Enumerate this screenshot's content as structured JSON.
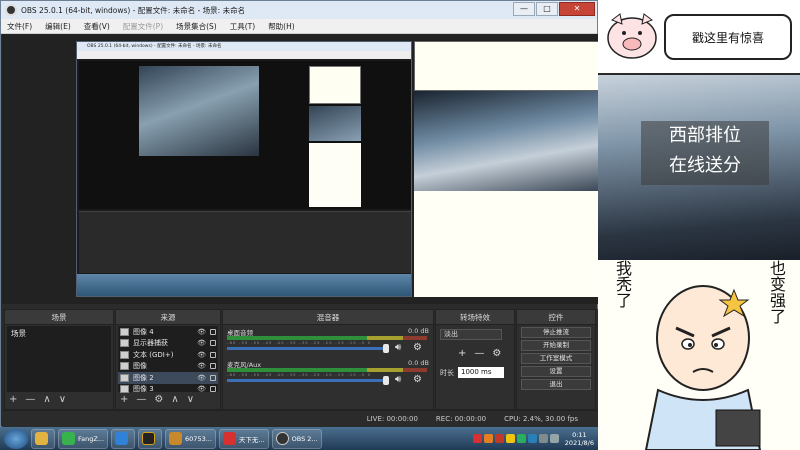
{
  "window": {
    "title": "OBS 25.0.1 (64-bit, windows) - 配置文件: 未命名 - 场景: 未命名",
    "controls": [
      "—",
      "□",
      "✕"
    ]
  },
  "menu": [
    "文件(F)",
    "编辑(E)",
    "查看(V)",
    "配置文件(P)",
    "场景集合(S)",
    "工具(T)",
    "帮助(H)"
  ],
  "nested_window": {
    "title": "OBS 25.0.1 (64-bit, windows) - 配置文件: 未命名 - 场景: 未命名"
  },
  "docks": {
    "scenes": {
      "header": "场景",
      "items": [
        "场景"
      ],
      "footer": [
        "+",
        "—",
        "∧",
        "∨"
      ]
    },
    "sources": {
      "header": "来源",
      "items": [
        {
          "label": "图像 4",
          "selected": false
        },
        {
          "label": "显示器捕获",
          "selected": false
        },
        {
          "label": "文本 (GDI+)",
          "selected": false
        },
        {
          "label": "图像",
          "selected": false
        },
        {
          "label": "图像 2",
          "selected": true
        },
        {
          "label": "图像 3",
          "selected": false
        }
      ],
      "footer": [
        "+",
        "—",
        "⚙",
        "∧",
        "∨"
      ]
    },
    "mixer": {
      "header": "混音器",
      "channels": [
        {
          "name": "桌面音频",
          "db": "0.0 dB"
        },
        {
          "name": "麦克风/Aux",
          "db": "0.0 dB"
        }
      ],
      "scale": "-60 -55 -50 -45 -40 -35 -30 -25 -20 -15 -10 -5 0"
    },
    "transitions": {
      "header": "转场特效",
      "type": "淡出",
      "duration_label": "时长",
      "duration": "1000 ms"
    },
    "controls": {
      "header": "控件",
      "buttons": [
        "停止推流",
        "开始录制",
        "工作室模式",
        "设置",
        "退出"
      ]
    }
  },
  "status": {
    "live": "LIVE: 00:00:00",
    "rec": "REC: 00:00:00",
    "cpu": "CPU: 2.4%, 30.00 fps"
  },
  "taskbar": {
    "buttons": [
      "FangZ...",
      "60753...",
      "天下无...",
      "OBS 2..."
    ],
    "clock_time": "0:11",
    "clock_date": "2021/8/6"
  },
  "camera_panel": {
    "bubble": "戳这里有惊喜",
    "banner_line1": "西部排位",
    "banner_line2": "在线送分",
    "meme_left": "我秃了",
    "meme_right": "也变强了"
  },
  "colors": {
    "obs_bg": "#2b2b2b",
    "selected_row": "#3c4a5c",
    "meter_green": "#2f8f3a",
    "meter_yellow": "#a6a12f",
    "meter_red": "#8e3b2f",
    "slider_blue": "#3c6fb5",
    "close_red": "#c74536"
  }
}
